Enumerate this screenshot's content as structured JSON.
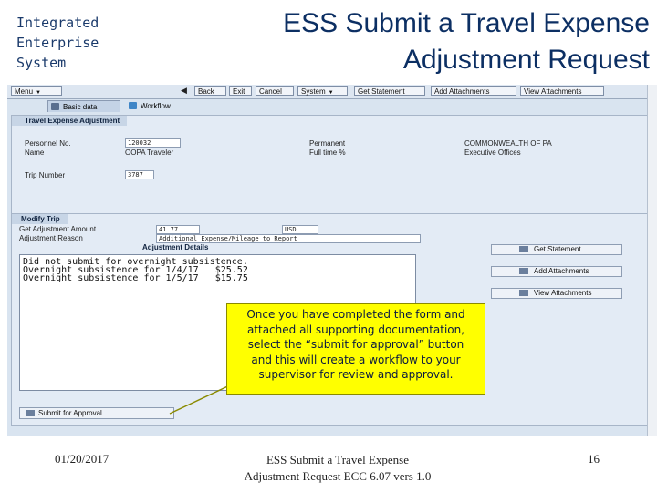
{
  "slide": {
    "org_lines": [
      "Integrated",
      "Enterprise",
      "System"
    ],
    "title_line1": "ESS Submit a Travel Expense",
    "title_line2": "Adjustment Request"
  },
  "toolbar": {
    "menu": "Menu",
    "back": "Back",
    "exit": "Exit",
    "cancel": "Cancel",
    "system": "System",
    "get_statement": "Get Statement",
    "add_attachments": "Add Attachments",
    "view_attachments": "View Attachments"
  },
  "tabs": {
    "basic_data": "Basic data",
    "workflow": "Workflow"
  },
  "adjustment_panel": {
    "header": "Travel Expense Adjustment",
    "personnel_no_label": "Personnel No.",
    "personnel_no_value": "120032",
    "name_label": "Name",
    "name_value": "OOPA Traveler",
    "permanent_label": "Permanent",
    "full_time_label": "Full time %",
    "org_value": "COMMONWEALTH OF PA",
    "org_unit_value": "Executive Offices",
    "trip_number_label": "Trip Number",
    "trip_number_value": "3787"
  },
  "modify_trip": {
    "header": "Modify Trip",
    "amount_label": "Get Adjustment Amount",
    "amount_value": "41.77",
    "currency": "USD",
    "reason_label": "Adjustment Reason",
    "reason_value": "Additional Expense/Mileage to Report",
    "details_label": "Adjustment Details",
    "details_text": [
      "Did not submit for overnight subsistence.",
      "",
      "Overnight subsistence for 1/4/17   $25.52",
      "Overnight subsistence for 1/5/17   $15.75"
    ]
  },
  "side_buttons": {
    "get_statement": "Get Statement",
    "add_attachments": "Add Attachments",
    "view_attachments": "View Attachments"
  },
  "submit_button": "Submit for Approval",
  "callout": [
    "Once you have completed the form and",
    "attached all supporting documentation,",
    "select the “submit for approval” button",
    "and this will create a workflow to your",
    "supervisor for review and approval."
  ],
  "footer": {
    "date": "01/20/2017",
    "doc_line1": "ESS Submit a Travel Expense",
    "doc_line2": "Adjustment Request ECC 6.07 vers 1.0",
    "page": "16"
  },
  "colors": {
    "title": "#0c2f63",
    "callout_bg": "#ffff00",
    "sap_bg": "#d9e4f0"
  },
  "icons": [
    "dropdown-icon",
    "back-arrow-icon",
    "statement-icon",
    "attachment-icon",
    "view-icon",
    "submit-icon"
  ]
}
